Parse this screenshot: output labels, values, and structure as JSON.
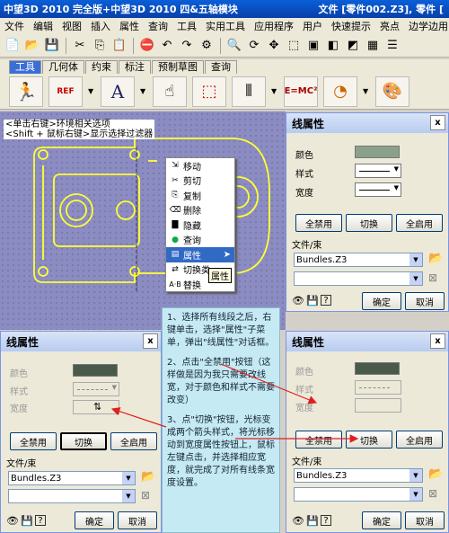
{
  "titlebar": {
    "title": "中望3D 2010 完全版+中望3D 2010 四&五轴模块",
    "right": "文件 [零件002.Z3], 零件 ["
  },
  "menubar": {
    "items": [
      "文件",
      "编辑",
      "视图",
      "插入",
      "属性",
      "查询",
      "工具",
      "实用工具",
      "应用程序",
      "用户",
      "快速提示",
      "亮点",
      "边学边用",
      "帮助"
    ]
  },
  "tabs": {
    "items": [
      "工具",
      "几何体",
      "约束",
      "标注",
      "预制草图",
      "查询"
    ],
    "active": "工具"
  },
  "toolbar2": {
    "labels": [
      "REF",
      "A",
      "E=MC²"
    ]
  },
  "canvas": {
    "hint1": "<单击右键>环境相关选项",
    "hint2": "<Shift + 鼠标右键>显示选择过滤器"
  },
  "context_menu": {
    "items": [
      "移动",
      "剪切",
      "复制",
      "删除",
      "隐藏",
      "查询",
      "属性",
      "切换类",
      "替换"
    ],
    "highlighted": "属性",
    "tooltip": "属性"
  },
  "panels": {
    "title": "线属性",
    "color_label": "颜色",
    "style_label": "样式",
    "width_label": "宽度",
    "disable_all": "全禁用",
    "toggle": "切换",
    "enable_all": "全启用",
    "file_group": "文件/束",
    "file_value": "Bundles.Z3",
    "ok": "确定",
    "cancel": "取消",
    "close": "x"
  },
  "description": {
    "p1": "1、选择所有线段之后，右键单击，选择\"属性\"子菜单，弹出\"线属性\"对话框。",
    "p2": "2、点击\"全禁用\"按钮（这样做是因为我只需要改线宽，对于颜色和样式不需要改变）",
    "p3": "3、点\"切换\"按钮，光标变成两个箭头样式，将光标移动到宽度属性按钮上，鼠标左键点击，并选择相应宽度，就完成了对所有线条宽度设置。"
  },
  "colors": {
    "accent": "#316ac5",
    "canvas_bg": "#8c8cc4",
    "sketch_line": "#ffff33",
    "arrow": "#e02020"
  }
}
